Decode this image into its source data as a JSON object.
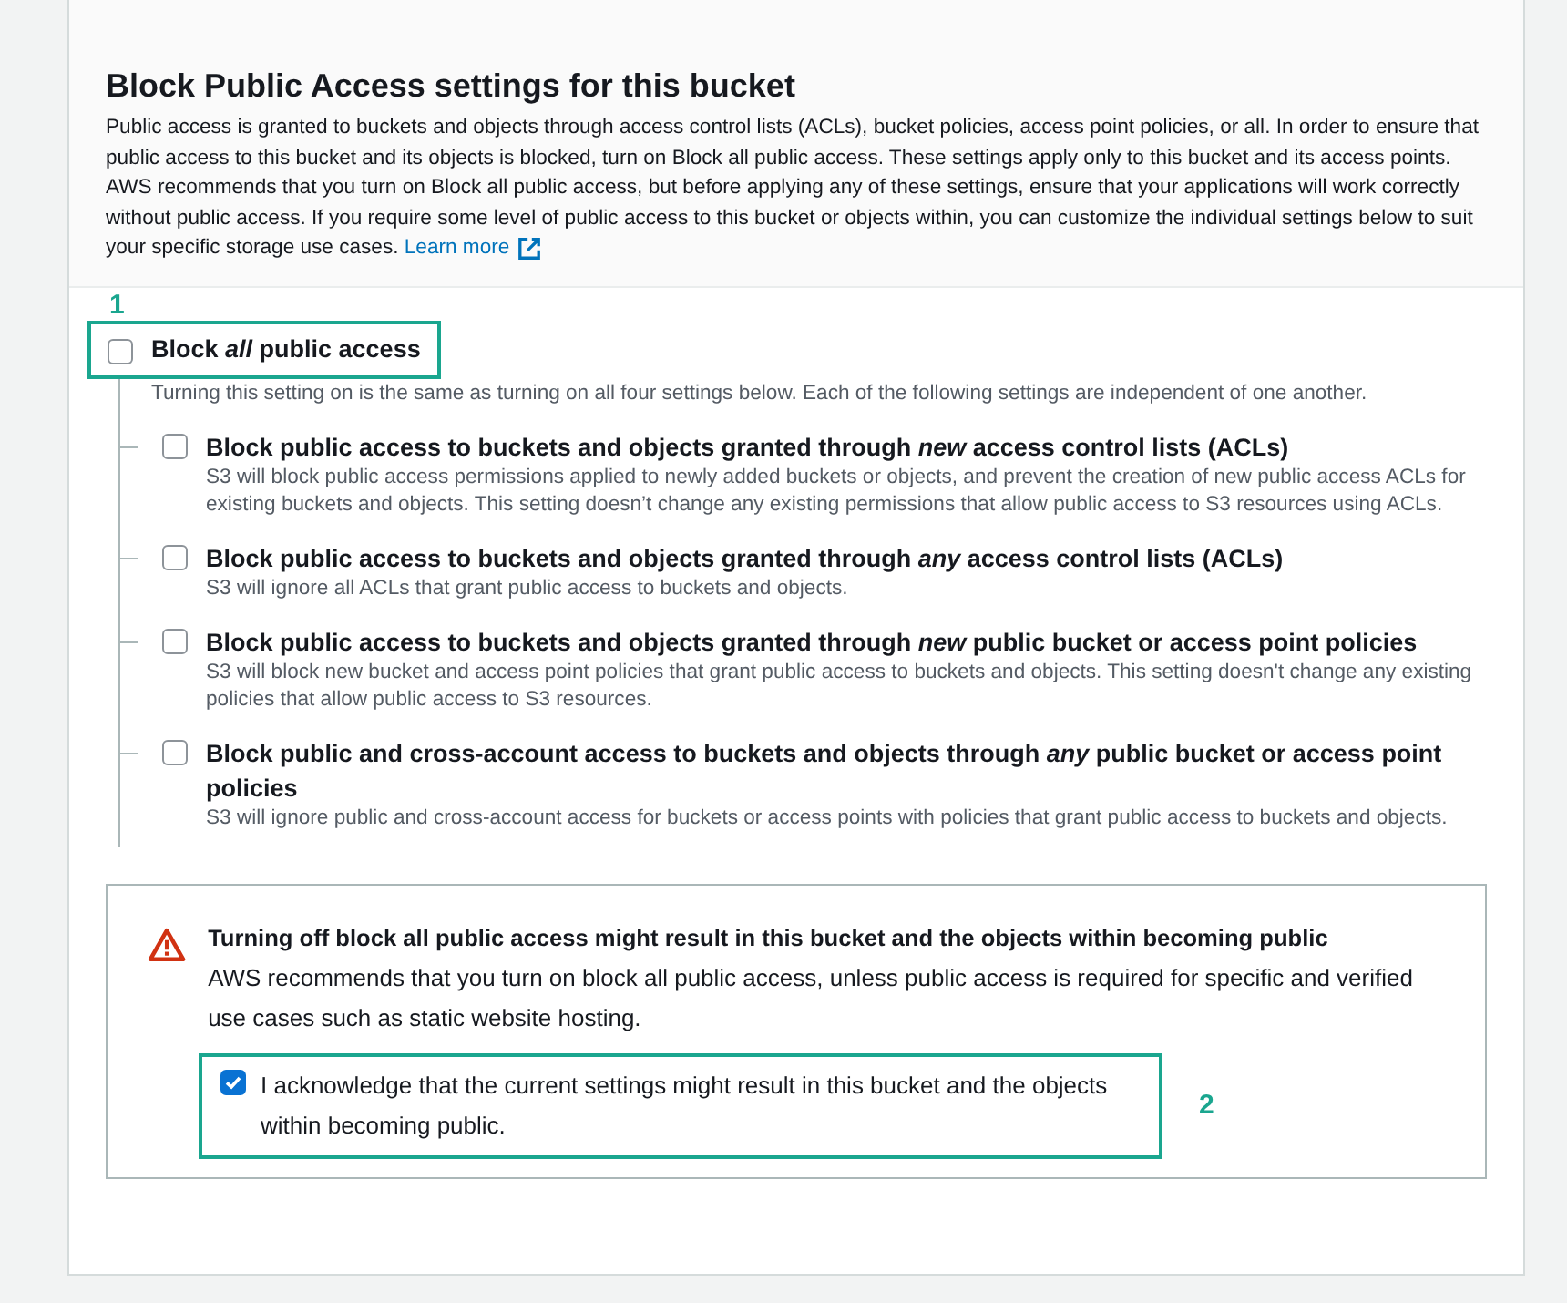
{
  "panel": {
    "title": "Block Public Access settings for this bucket",
    "description": "Public access is granted to buckets and objects through access control lists (ACLs), bucket policies, access point policies, or all. In order to ensure that public access to this bucket and its objects is blocked, turn on Block all public access. These settings apply only to this bucket and its access points. AWS recommends that you turn on Block all public access, but before applying any of these settings, ensure that your applications will work correctly without public access. If you require some level of public access to this bucket or objects within, you can customize the individual settings below to suit your specific storage use cases.",
    "learn_more": "Learn more"
  },
  "block_all": {
    "callout": "1",
    "label": "Block *all* public access",
    "checked": false,
    "description": "Turning this setting on is the same as turning on all four settings below. Each of the following settings are independent of one another."
  },
  "settings": [
    {
      "label": "Block public access to buckets and objects granted through *new* access control lists (ACLs)",
      "checked": false,
      "description": "S3 will block public access permissions applied to newly added buckets or objects, and prevent the creation of new public access ACLs for existing buckets and objects. This setting doesn’t change any existing permissions that allow public access to S3 resources using ACLs."
    },
    {
      "label": "Block public access to buckets and objects granted through *any* access control lists (ACLs)",
      "checked": false,
      "description": "S3 will ignore all ACLs that grant public access to buckets and objects."
    },
    {
      "label": "Block public access to buckets and objects granted through *new* public bucket or access point policies",
      "checked": false,
      "description": "S3 will block new bucket and access point policies that grant public access to buckets and objects. This setting doesn't change any existing policies that allow public access to S3 resources."
    },
    {
      "label": "Block public and cross-account access to buckets and objects through *any* public bucket or access point policies",
      "checked": false,
      "description": "S3 will ignore public and cross-account access for buckets or access points with policies that grant public access to buckets and objects."
    }
  ],
  "warning": {
    "title": "Turning off block all public access might result in this bucket and the objects within becoming public",
    "text": "AWS recommends that you turn on block all public access, unless public access is required for specific and verified use cases such as static website hosting.",
    "acknowledge": {
      "label": "I acknowledge that the current settings might result in this bucket and the objects within becoming public.",
      "checked": true,
      "callout": "2"
    }
  }
}
